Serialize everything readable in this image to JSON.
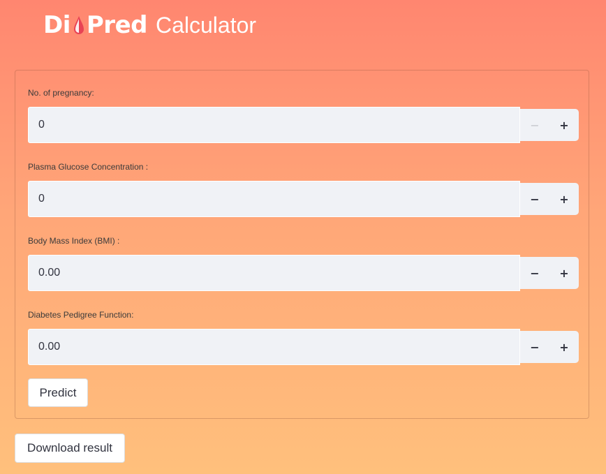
{
  "header": {
    "logo_text_part1": "Di",
    "logo_text_part2": "Pred",
    "logo_subtitle": "Calculator",
    "logo_icon": "blood-drop-icon",
    "logo_drop_color": "#e84355"
  },
  "form": {
    "fields": [
      {
        "label": "No. of pregnancy:",
        "value": "0",
        "minus_enabled": false
      },
      {
        "label": "Plasma Glucose Concentration :",
        "value": "0",
        "minus_enabled": true
      },
      {
        "label": "Body Mass Index (BMI) :",
        "value": "0.00",
        "minus_enabled": true
      },
      {
        "label": "Diabetes Pedigree Function:",
        "value": "0.00",
        "minus_enabled": true
      }
    ],
    "minus_symbol": "−",
    "plus_symbol": "+",
    "predict_label": "Predict"
  },
  "download_label": "Download result",
  "colors": {
    "gradient_top": "#ff8670",
    "gradient_bottom": "#ffc07c",
    "input_bg": "#f0f2f6",
    "text": "#31333f"
  }
}
